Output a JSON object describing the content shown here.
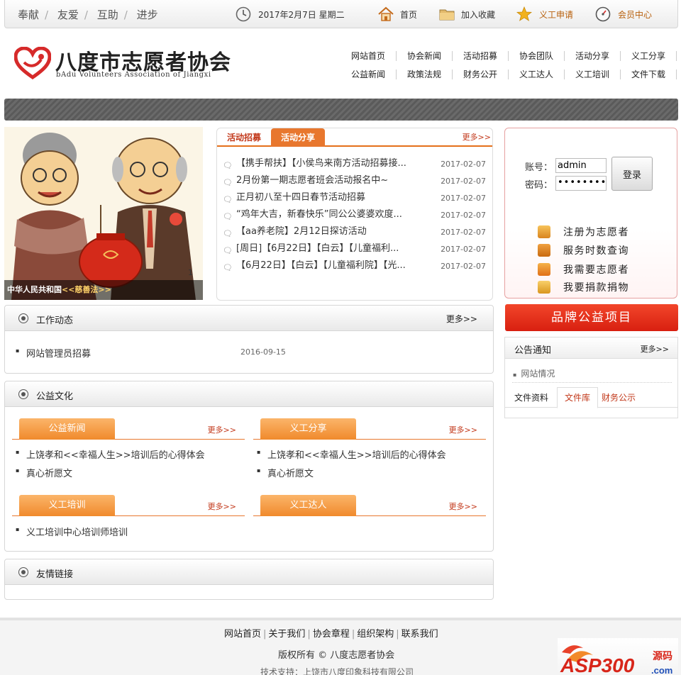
{
  "topbar": {
    "slogans": [
      "奉献",
      "友爱",
      "互助",
      "进步"
    ],
    "slogan_sep": "/",
    "date": "2017年2月7日 星期二",
    "home": "首页",
    "favorite": "加入收藏",
    "volunteer_apply": "义工申请",
    "member_center": "会员中心"
  },
  "header": {
    "title": "八度市志愿者协会",
    "subtitle": "bAdu Volunteers Association of Jiangxi"
  },
  "nav": {
    "row1": [
      "网站首页",
      "协会新闻",
      "活动招募",
      "协会团队",
      "活动分享",
      "义工分享"
    ],
    "row2": [
      "公益新闻",
      "政策法规",
      "财务公开",
      "义工达人",
      "义工培训",
      "文件下载"
    ]
  },
  "banner": {
    "caption_a": "中华人民共和国",
    "caption_b": "<<慈善法>>",
    "page_num": "1"
  },
  "activity": {
    "tab1": "活动招募",
    "tab2": "活动分享",
    "more": "更多>>",
    "items": [
      {
        "title": "【携手帮扶】【小侯鸟来南方活动招募接...",
        "date": "2017-02-07"
      },
      {
        "title": "2月份第一期志愿者班会活动报名中~",
        "date": "2017-02-07"
      },
      {
        "title": "正月初八至十四日春节活动招募",
        "date": "2017-02-07"
      },
      {
        "title": "“鸡年大吉，新春快乐”同公公婆婆欢度...",
        "date": "2017-02-07"
      },
      {
        "title": "【aa养老院】2月12日探访活动",
        "date": "2017-02-07"
      },
      {
        "title": "[周日]【6月22日】【白云】【儿童福利...",
        "date": "2017-02-07"
      },
      {
        "title": "【6月22日】【白云】【儿童福利院】【光...",
        "date": "2017-02-07"
      }
    ]
  },
  "login": {
    "account_label": "账号：",
    "password_label": "密码：",
    "account_value": "admin",
    "password_value": "••••••••",
    "button": "登录",
    "links": [
      "注册为志愿者",
      "服务时数查询",
      "我需要志愿者",
      "我要捐款捐物"
    ]
  },
  "brand": {
    "label": "品牌公益项目"
  },
  "notice": {
    "title": "公告通知",
    "more": "更多>>",
    "item": "网站情况",
    "tabs": [
      "文件资料",
      "文件库",
      "财务公示"
    ]
  },
  "work": {
    "title": "工作动态",
    "more": "更多>>",
    "item": "网站管理员招募",
    "date": "2016-09-15"
  },
  "culture": {
    "title": "公益文化",
    "blocks": [
      {
        "tab": "公益新闻",
        "more": "更多>>",
        "items": [
          "上饶孝和<<幸福人生>>培训后的心得体会",
          "真心祈愿文"
        ]
      },
      {
        "tab": "义工分享",
        "more": "更多>>",
        "items": [
          "上饶孝和<<幸福人生>>培训后的心得体会",
          "真心祈愿文"
        ]
      },
      {
        "tab": "义工培训",
        "more": "更多>>",
        "items": [
          "义工培训中心培训师培训"
        ]
      },
      {
        "tab": "义工达人",
        "more": "更多>>",
        "items": []
      }
    ]
  },
  "links": {
    "title": "友情链接"
  },
  "footer": {
    "links": [
      "网站首页",
      "关于我们",
      "协会章程",
      "组织架构",
      "联系我们"
    ],
    "sep": "|",
    "copyright": "版权所有 © 八度志愿者协会",
    "tech": "技术支持：上饶市八度印象科技有限公司",
    "badge_text": "ASP300",
    "badge_sub": "源码",
    "badge_com": ".com"
  },
  "colors": {
    "accent_orange": "#e8772e",
    "accent_red": "#c2381a",
    "brand_red": "#d81f10"
  }
}
